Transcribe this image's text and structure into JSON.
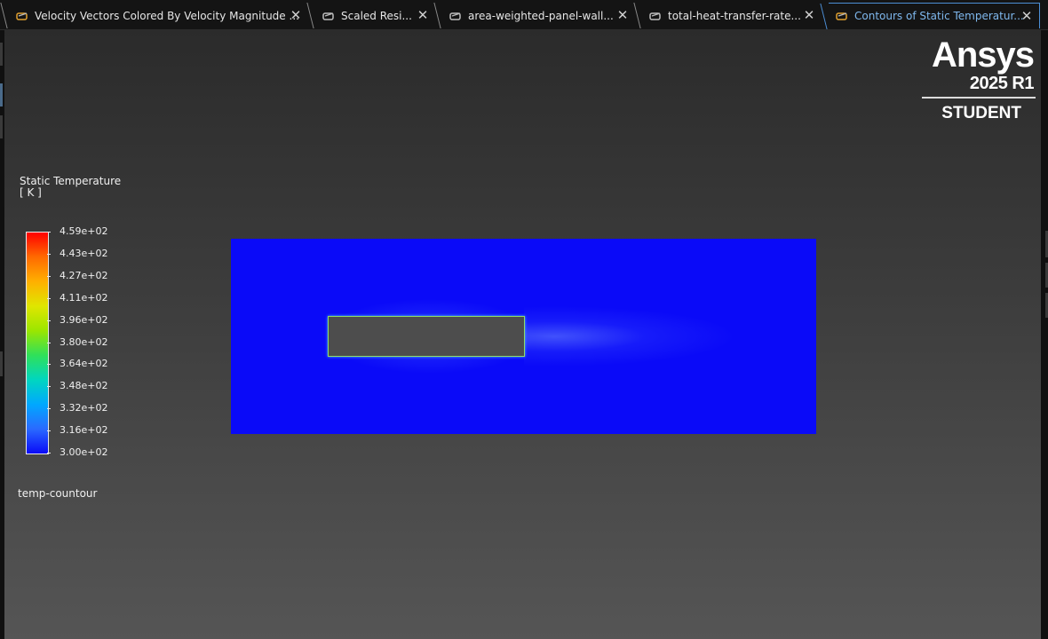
{
  "tabs": [
    {
      "label": "Velocity Vectors Colored By Velocity Magnitude ...",
      "icon": "graphics-window-icon",
      "active": false
    },
    {
      "label": "Scaled Resi...",
      "icon": "graphics-window-icon",
      "active": false
    },
    {
      "label": "area-weighted-panel-wall...",
      "icon": "graphics-window-icon",
      "active": false
    },
    {
      "label": "total-heat-transfer-rate...",
      "icon": "graphics-window-icon",
      "active": false
    },
    {
      "label": "Contours of Static Temperatur...",
      "icon": "graphics-window-icon",
      "active": true
    }
  ],
  "close_glyph": "✕",
  "logo": {
    "brand": "Ansys",
    "version": "2025 R1",
    "edition": "STUDENT"
  },
  "legend": {
    "title": "Static Temperature",
    "unit": "[ K ]",
    "labels": [
      "4.59e+02",
      "4.43e+02",
      "4.27e+02",
      "4.11e+02",
      "3.96e+02",
      "3.80e+02",
      "3.64e+02",
      "3.48e+02",
      "3.32e+02",
      "3.16e+02",
      "3.00e+02"
    ],
    "colormap": [
      "#ff0000",
      "#ff6a00",
      "#ffb000",
      "#dfe600",
      "#9be600",
      "#2fe05a",
      "#00d6c0",
      "#00a8ff",
      "#2a6aff",
      "#0a0af8"
    ]
  },
  "contour_name": "temp-countour",
  "colors": {
    "background_top": "#2b2b2b",
    "background_bottom": "#555555",
    "field": "#0a0af8",
    "accent": "#7fb8ee"
  }
}
